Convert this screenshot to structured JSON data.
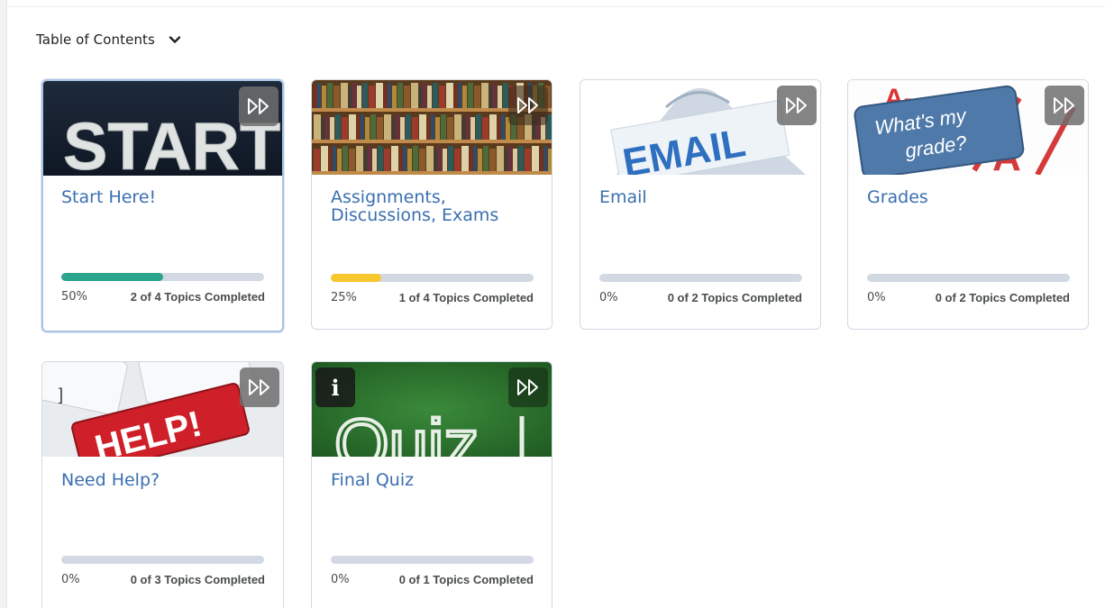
{
  "toc": {
    "title": "Table of Contents"
  },
  "colors": {
    "link": "#3a6fb0",
    "progress_track": "#d3d9e3",
    "progress_green": "#2aa58b",
    "progress_yellow": "#f7c82d"
  },
  "modules": [
    {
      "title": "Start Here!",
      "percent_label": "50%",
      "progress": 0.5,
      "topics_label": "2 of 4 Topics Completed",
      "image_text": "START",
      "icon": "fast-forward-icon"
    },
    {
      "title": "Assignments, Discussions, Exams",
      "percent_label": "25%",
      "progress": 0.25,
      "topics_label": "1 of 4 Topics Completed",
      "icon": "fast-forward-icon"
    },
    {
      "title": "Email",
      "percent_label": "0%",
      "progress": 0,
      "topics_label": "0 of 2 Topics Completed",
      "image_text": "EMAIL",
      "icon": "fast-forward-icon"
    },
    {
      "title": "Grades",
      "percent_label": "0%",
      "progress": 0,
      "topics_label": "0 of 2 Topics Completed",
      "image_text": "What's my grade?",
      "icon": "fast-forward-icon"
    },
    {
      "title": "Need Help?",
      "percent_label": "0%",
      "progress": 0,
      "topics_label": "0 of 3 Topics Completed",
      "image_text": "HELP!",
      "icon": "fast-forward-icon"
    },
    {
      "title": "Final Quiz",
      "percent_label": "0%",
      "progress": 0,
      "topics_label": "0 of 1 Topics Completed",
      "image_text": "Quiz",
      "icon": "fast-forward-icon",
      "info_icon": "i"
    }
  ]
}
